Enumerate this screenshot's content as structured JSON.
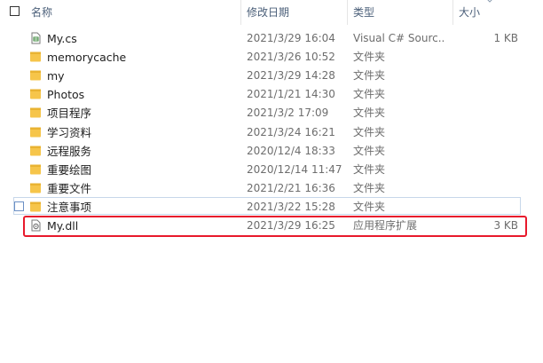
{
  "columns": {
    "name": "名称",
    "date": "修改日期",
    "type": "类型",
    "size": "大小"
  },
  "colors": {
    "folder": "#f6c54a",
    "highlight": "#e8192c",
    "header_text": "#4c607a"
  },
  "files": [
    {
      "name": "My.cs",
      "date": "2021/3/29 16:04",
      "type": "Visual C# Sourc...",
      "size": "1 KB",
      "icon": "csharp-file-icon"
    },
    {
      "name": "memorycache",
      "date": "2021/3/26 10:52",
      "type": "文件夹",
      "size": "",
      "icon": "folder-icon"
    },
    {
      "name": "my",
      "date": "2021/3/29 14:28",
      "type": "文件夹",
      "size": "",
      "icon": "folder-icon"
    },
    {
      "name": "Photos",
      "date": "2021/1/21 14:30",
      "type": "文件夹",
      "size": "",
      "icon": "folder-icon"
    },
    {
      "name": "项目程序",
      "date": "2021/3/2 17:09",
      "type": "文件夹",
      "size": "",
      "icon": "folder-icon"
    },
    {
      "name": "学习资料",
      "date": "2021/3/24 16:21",
      "type": "文件夹",
      "size": "",
      "icon": "folder-icon"
    },
    {
      "name": "远程服务",
      "date": "2020/12/4 18:33",
      "type": "文件夹",
      "size": "",
      "icon": "folder-icon"
    },
    {
      "name": "重要绘图",
      "date": "2020/12/14 11:47",
      "type": "文件夹",
      "size": "",
      "icon": "folder-icon"
    },
    {
      "name": "重要文件",
      "date": "2021/2/21 16:36",
      "type": "文件夹",
      "size": "",
      "icon": "folder-icon"
    },
    {
      "name": "注意事项",
      "date": "2021/3/22 15:28",
      "type": "文件夹",
      "size": "",
      "icon": "folder-icon"
    },
    {
      "name": "My.dll",
      "date": "2021/3/29 16:25",
      "type": "应用程序扩展",
      "size": "3 KB",
      "icon": "dll-file-icon"
    }
  ]
}
